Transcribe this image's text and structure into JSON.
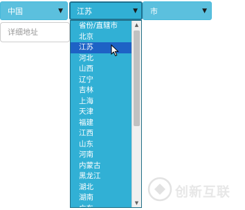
{
  "country_select": {
    "value": "中国"
  },
  "province_select": {
    "value": "江苏"
  },
  "city_select": {
    "value": "市"
  },
  "address_input": {
    "placeholder": "详细地址"
  },
  "province_options": [
    "省份/直辖市",
    "北京",
    "江苏",
    "河北",
    "山西",
    "辽宁",
    "吉林",
    "上海",
    "天津",
    "福建",
    "江西",
    "山东",
    "河南",
    "内蒙古",
    "黑龙江",
    "湖北",
    "湖南",
    "广东"
  ],
  "highlighted_option": "江苏",
  "watermark": {
    "text": "创新互联"
  },
  "colors": {
    "select_bg": "#5bc0de",
    "dropdown_bg": "#31b0d5",
    "highlight": "#1e62c5"
  }
}
